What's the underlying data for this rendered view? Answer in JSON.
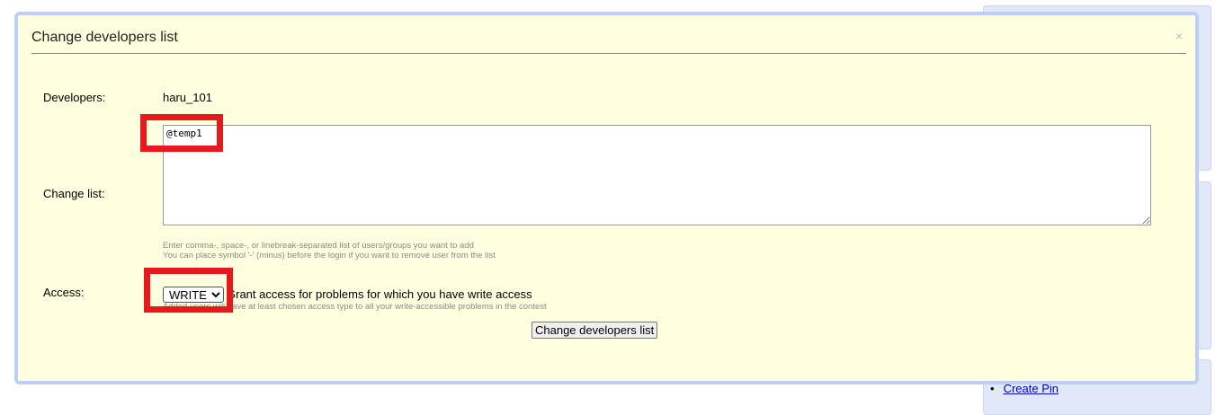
{
  "modal": {
    "title": "Change developers list",
    "close_glyph": "×"
  },
  "developers": {
    "label": "Developers:",
    "value": "haru_101"
  },
  "change_list": {
    "label": "Change list:",
    "value": "@temp1",
    "hint_line1": "Enter comma-, space-, or linebreak-separated list of users/groups you want to add",
    "hint_line2": "You can place symbol '-' (minus) before the login if you want to remove user from the list"
  },
  "access": {
    "label": "Access:",
    "selected": "WRITE",
    "description": "Grant access for problems for which you have write access",
    "hint": "Added users will have at least chosen access type to all your write-accessible problems in the contest"
  },
  "submit_label": "Change developers list",
  "background": {
    "link_text": "Create Pin"
  },
  "colors": {
    "modal_bg": "#ffffe0",
    "modal_border": "#bcd0f7",
    "highlight": "#e8191c"
  }
}
